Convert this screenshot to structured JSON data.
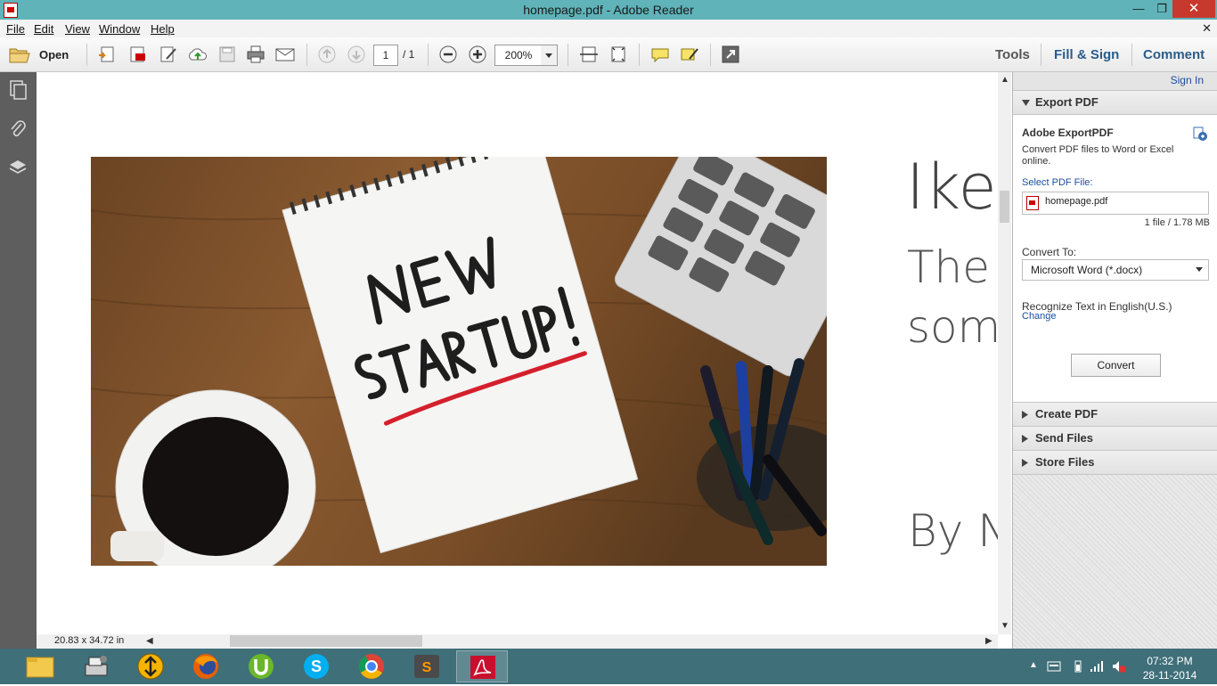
{
  "window": {
    "title": "homepage.pdf - Adobe Reader",
    "minimize": "—",
    "maximize": "❐",
    "close": "✕"
  },
  "menu": {
    "file": "File",
    "edit": "Edit",
    "view": "View",
    "window": "Window",
    "help": "Help",
    "doc_close": "✕"
  },
  "toolbar": {
    "open_label": "Open",
    "page_current": "1",
    "page_total": "/ 1",
    "zoom": "200%",
    "tabs": {
      "tools": "Tools",
      "fill_sign": "Fill & Sign",
      "comment": "Comment"
    }
  },
  "document": {
    "heading": "Ike",
    "line1": "The",
    "line2": "som",
    "byline": "By N",
    "page_size": "20.83 x 34.72 in"
  },
  "right_panel": {
    "sign_in": "Sign In",
    "export": {
      "title": "Export PDF",
      "service": "Adobe ExportPDF",
      "description": "Convert PDF files to Word or Excel online.",
      "select_label": "Select PDF File:",
      "file_name": "homepage.pdf",
      "file_info": "1 file / 1.78 MB",
      "convert_to_label": "Convert To:",
      "convert_to_value": "Microsoft Word (*.docx)",
      "recognize": "Recognize Text in English(U.S.)",
      "change": "Change",
      "convert_button": "Convert"
    },
    "sections": {
      "create": "Create PDF",
      "send": "Send Files",
      "store": "Store Files"
    }
  },
  "taskbar": {
    "apps": [
      "file-explorer",
      "printer",
      "download-manager",
      "firefox",
      "utorrent",
      "skype",
      "chrome",
      "sublime-text",
      "adobe-reader"
    ],
    "clock_time": "07:32 PM",
    "clock_date": "28-11-2014"
  },
  "colors": {
    "titlebar": "#5fb3b9",
    "taskbar": "#3f6f79",
    "link": "#1c4fa0",
    "close": "#c7392c"
  }
}
